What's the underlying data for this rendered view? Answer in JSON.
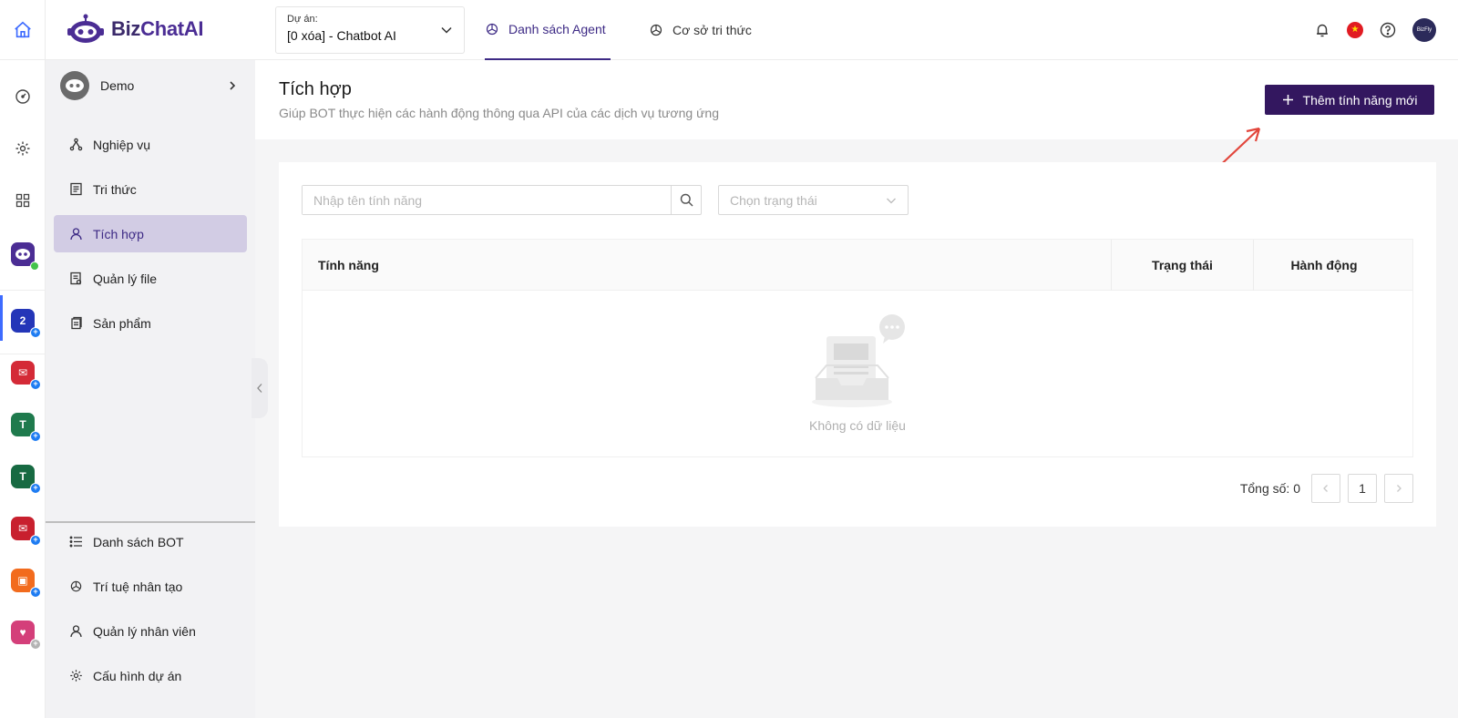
{
  "brand": {
    "biz": "Biz",
    "chat": "ChatAI"
  },
  "project": {
    "label": "Dự án:",
    "value": "[0 xóa] - Chatbot AI"
  },
  "tabs": [
    {
      "label": "Danh sách Agent",
      "active": true
    },
    {
      "label": "Cơ sở tri thức",
      "active": false
    }
  ],
  "header_icons": [
    "bell-icon",
    "vietnam-flag-icon",
    "help-icon",
    "user-avatar"
  ],
  "colors": {
    "primary": "#33175f",
    "accent_tab": "#3d2a85",
    "active_menu_bg": "#d2cce4"
  },
  "rail": {
    "items": [
      "home-icon",
      "dashboard-icon",
      "settings-icon",
      "apps-grid-icon",
      "bizchat-bot-app",
      "app-blue",
      "app-mail-red",
      "app-teal-1",
      "app-teal-2",
      "app-mail-red-2",
      "app-orange",
      "app-pink"
    ]
  },
  "bot": {
    "name": "Demo"
  },
  "menu": {
    "items": [
      {
        "label": "Nghiệp vụ",
        "icon": "workflow-icon"
      },
      {
        "label": "Tri thức",
        "icon": "document-icon"
      },
      {
        "label": "Tích hợp",
        "icon": "user-icon",
        "active": true
      },
      {
        "label": "Quản lý file",
        "icon": "file-icon"
      },
      {
        "label": "Sản phẩm",
        "icon": "product-icon"
      }
    ],
    "bottom": [
      {
        "label": "Danh sách BOT",
        "icon": "list-icon"
      },
      {
        "label": "Trí tuệ nhân tạo",
        "icon": "ai-icon"
      },
      {
        "label": "Quản lý nhân viên",
        "icon": "person-icon"
      },
      {
        "label": "Cấu hình dự án",
        "icon": "gear-icon"
      }
    ]
  },
  "page": {
    "title": "Tích hợp",
    "subtitle": "Giúp BOT thực hiện các hành động thông qua API của các dịch vụ tương ứng",
    "add_button": "Thêm tính năng mới"
  },
  "filters": {
    "search_placeholder": "Nhập tên tính năng",
    "status_placeholder": "Chọn trạng thái"
  },
  "table": {
    "columns": [
      "Tính năng",
      "Trạng thái",
      "Hành động"
    ],
    "empty_text": "Không có dữ liệu"
  },
  "pagination": {
    "total_label": "Tổng số: 0",
    "current_page": "1"
  }
}
